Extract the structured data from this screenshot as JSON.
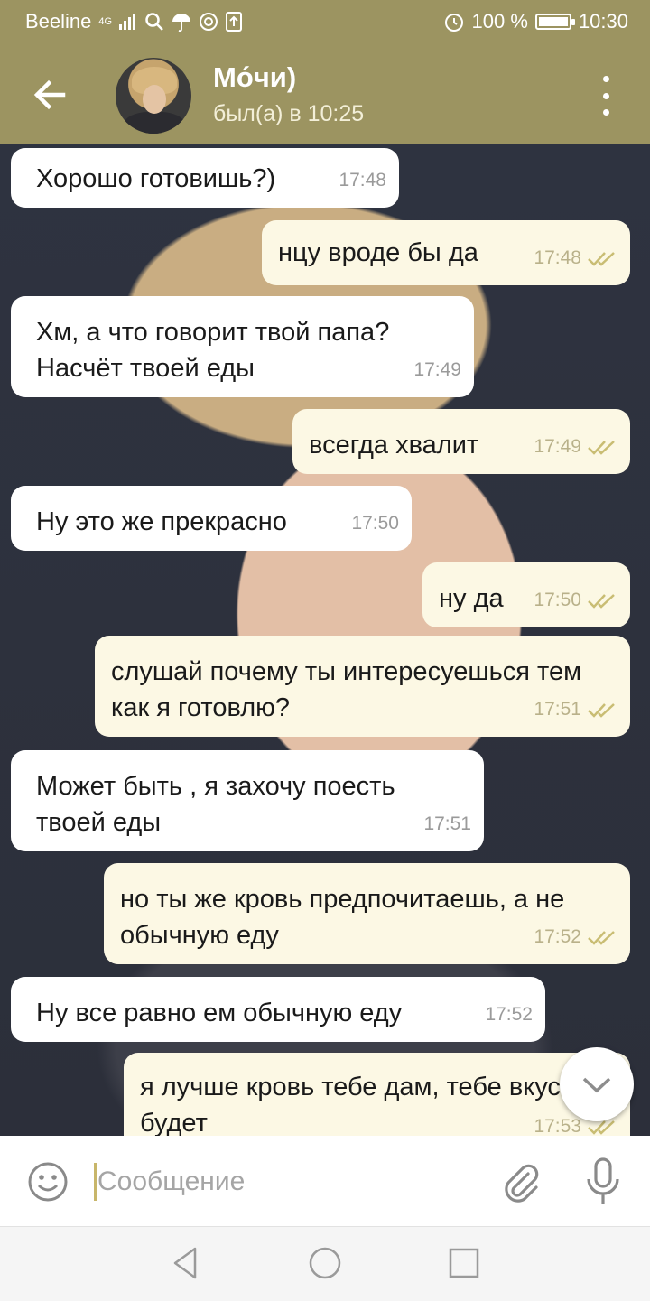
{
  "status_bar": {
    "carrier": "Beeline",
    "network": "4G",
    "battery": "100 %",
    "time": "10:30",
    "icons": [
      "signal-icon",
      "search-icon",
      "umbrella-icon",
      "at-icon",
      "upload-icon",
      "alarm-icon",
      "battery-icon"
    ]
  },
  "header": {
    "name": "Мо́чи)",
    "status": "был(а) в 10:25",
    "icons": [
      "back-arrow-icon",
      "avatar",
      "more-vert-icon"
    ]
  },
  "messages": [
    {
      "dir": "in",
      "text": "Хорошо готовишь?)",
      "time": "17:48"
    },
    {
      "dir": "out",
      "text": "нцу вроде бы да",
      "time": "17:48",
      "read": true
    },
    {
      "dir": "in",
      "text": "Хм, а что говорит твой папа? Насчёт твоей еды",
      "time": "17:49"
    },
    {
      "dir": "out",
      "text": "всегда хвалит",
      "time": "17:49",
      "read": true
    },
    {
      "dir": "in",
      "text": "Ну это же прекрасно",
      "time": "17:50"
    },
    {
      "dir": "out",
      "text": "ну да",
      "time": "17:50",
      "read": true
    },
    {
      "dir": "out",
      "text": "слушай почему ты интересуешься тем как я готовлю?",
      "time": "17:51",
      "read": true
    },
    {
      "dir": "in",
      "text": "Может быть , я захочу поесть твоей еды",
      "time": "17:51"
    },
    {
      "dir": "out",
      "text": "но ты же кровь предпочитаешь, а не обычную еду",
      "time": "17:52",
      "read": true
    },
    {
      "dir": "in",
      "text": "Ну все равно ем обычную еду",
      "time": "17:52"
    },
    {
      "dir": "out",
      "text": "я лучше кровь тебе дам, тебе вкуснее будет",
      "time": "17:53",
      "read": true
    }
  ],
  "composer": {
    "placeholder": "Сообщение",
    "icons": [
      "emoji-icon",
      "attach-icon",
      "mic-icon",
      "scroll-down-icon"
    ]
  },
  "navbar": {
    "icons": [
      "nav-back-icon",
      "nav-home-icon",
      "nav-recents-icon"
    ]
  },
  "colors": {
    "header": "#9c9461",
    "incoming_bubble": "#ffffff",
    "outgoing_bubble": "#fcf8e4",
    "tick": "#c9bd73"
  }
}
